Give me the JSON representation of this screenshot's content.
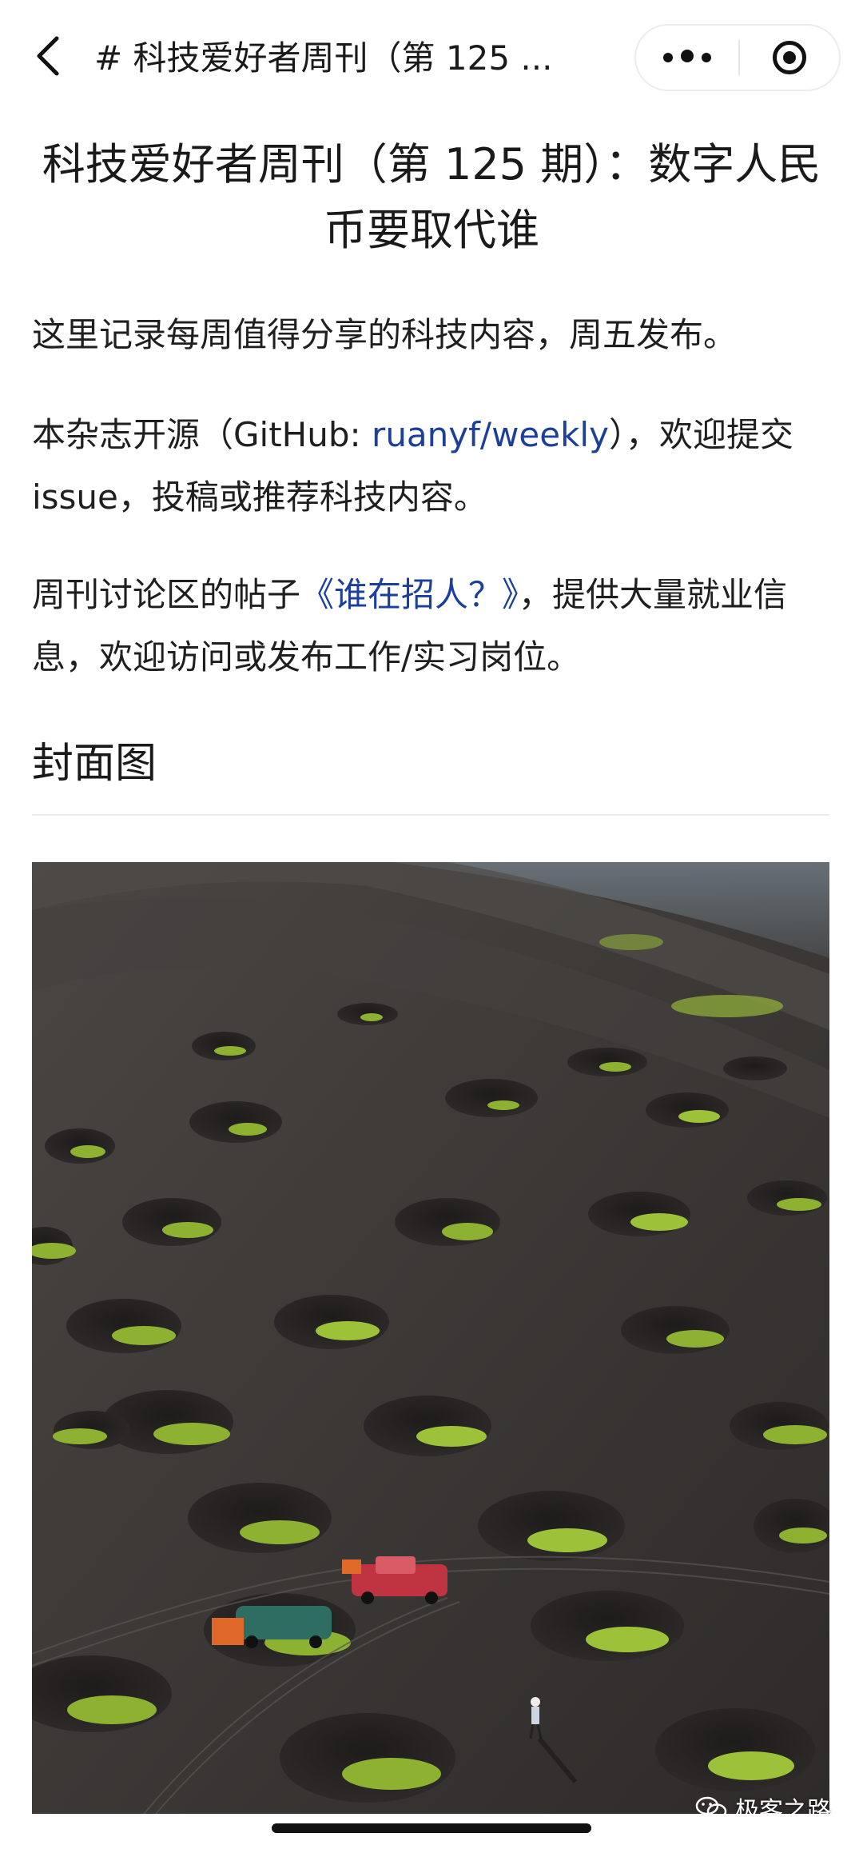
{
  "navbar": {
    "title": "# 科技爱好者周刊（第 125 ...",
    "back_icon": "chevron-left-icon",
    "more_icon": "more-dots-icon",
    "close_icon": "target-circle-icon"
  },
  "article": {
    "title": "科技爱好者周刊（第 125 期）：数字人民币要取代谁",
    "p1": "这里记录每周值得分享的科技内容，周五发布。",
    "p2_before": "本杂志开源（GitHub: ",
    "p2_link": "ruanyf/weekly",
    "p2_after": "），欢迎提交 issue，投稿或推荐科技内容。",
    "p3_before": "周刊讨论区的帖子",
    "p3_link": "《谁在招人？》",
    "p3_after": "，提供大量就业信息，欢迎访问或发布工作/实习岗位。",
    "section_heading": "封面图"
  },
  "cover": {
    "watermark": "极客之路",
    "watermark_icon": "wechat-icon"
  },
  "colors": {
    "link": "#1d3f9c",
    "soil": "#3b3837",
    "vine": "#7da82a"
  }
}
